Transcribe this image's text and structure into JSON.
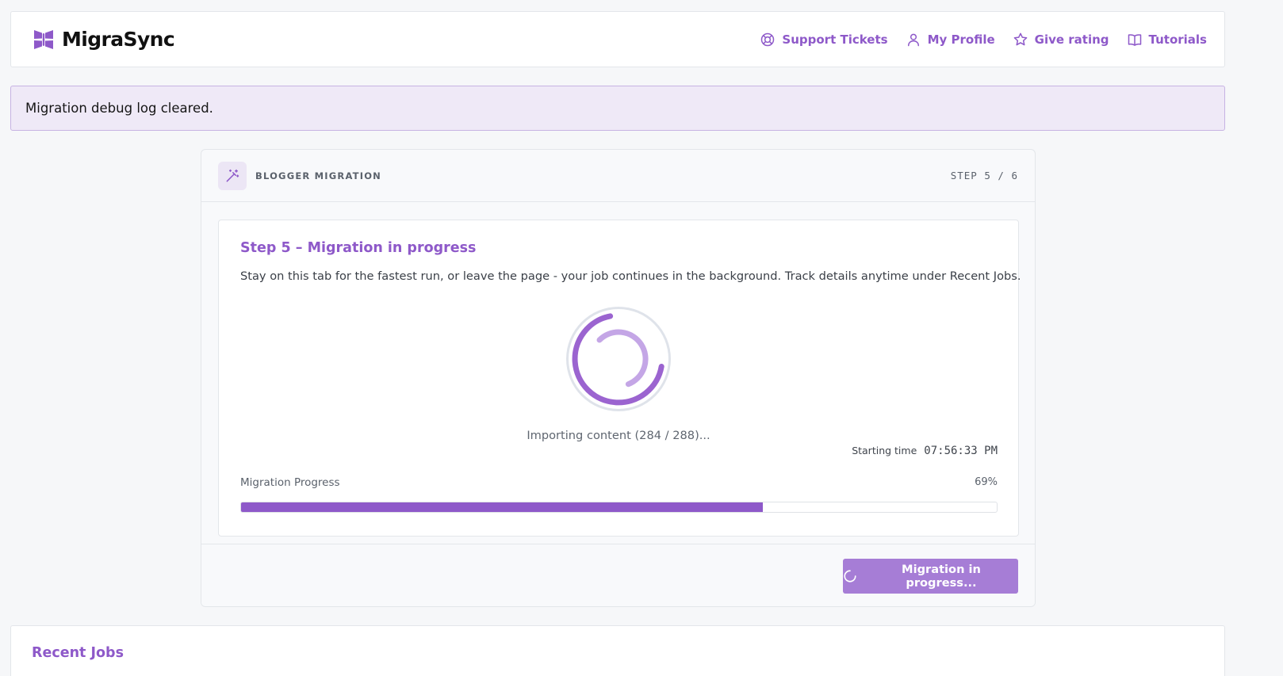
{
  "header": {
    "brand": "MigraSync",
    "logo_icon": "butterfly-logo-icon",
    "nav": [
      {
        "label": "Support Tickets",
        "icon": "lifebuoy-icon"
      },
      {
        "label": "My Profile",
        "icon": "user-icon"
      },
      {
        "label": "Give rating",
        "icon": "star-icon"
      },
      {
        "label": "Tutorials",
        "icon": "book-icon"
      }
    ]
  },
  "notice": {
    "text": "Migration debug log cleared."
  },
  "wizard": {
    "title": "BLOGGER MIGRATION",
    "step_indicator": "STEP 5 / 6",
    "icon": "magic-wand-icon",
    "step_heading": "Step 5 – Migration in progress",
    "description": "Stay on this tab for the fastest run, or leave the page - your job continues in the background. Track details anytime under Recent Jobs.",
    "status": "Importing content (284 / 288)...",
    "start_label": "Starting time",
    "start_time": "07:56:33 PM",
    "progress_label": "Migration Progress",
    "progress_text": "69%",
    "progress_value": 0.69,
    "button_label": "Migration in progress...",
    "button_icon": "loading-spinner-icon"
  },
  "recent_jobs": {
    "title": "Recent Jobs"
  },
  "colors": {
    "accent": "#8e59c9",
    "accent_light": "#a67dd6",
    "notice_bg": "#efe9f7",
    "notice_border": "#c7b3e3"
  }
}
